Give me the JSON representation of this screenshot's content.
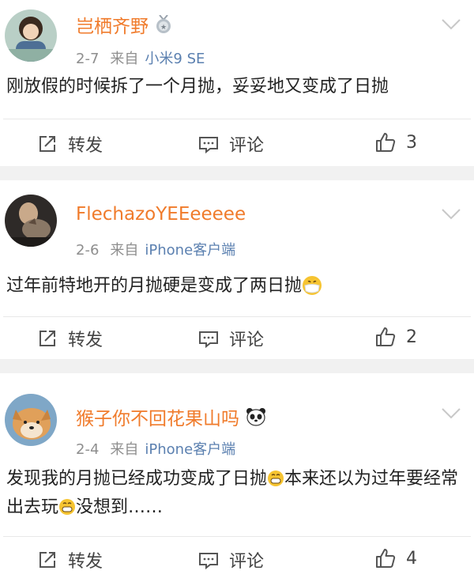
{
  "posts": [
    {
      "username": "岂栖齐野",
      "badge_icon": "medal-badge-icon",
      "date": "2-7",
      "source_prefix": "来自",
      "source": "小米9 SE",
      "content_parts": [
        "刚放假的时候拆了一个月抛，妥妥地又变成了日抛"
      ],
      "repost_label": "转发",
      "comment_label": "评论",
      "likes": "3"
    },
    {
      "username": "FlechazoYEEeeeee",
      "date": "2-6",
      "source_prefix": "来自",
      "source": "iPhone客户端",
      "content_parts": [
        "过年前特地开的月抛硬是变成了两日抛"
      ],
      "emoji_icon": "masked-face-emoji-icon",
      "repost_label": "转发",
      "comment_label": "评论",
      "likes": "2"
    },
    {
      "username": "猴子你不回花果山吗",
      "badge_icon": "panda-badge-icon",
      "date": "2-4",
      "source_prefix": "来自",
      "source": "iPhone客户端",
      "content_parts": [
        "发现我的月抛已经成功变成了日抛",
        "本来还以为过年要经常出去玩",
        "没想到……"
      ],
      "emoji_icon": "grinning-face-emoji-icon",
      "repost_label": "转发",
      "comment_label": "评论",
      "likes": "4"
    }
  ],
  "colors": {
    "username": "#f07b2b",
    "source_link": "#5b80b0",
    "meta_text": "#8e8e8e",
    "separator": "#f1f1f1"
  }
}
